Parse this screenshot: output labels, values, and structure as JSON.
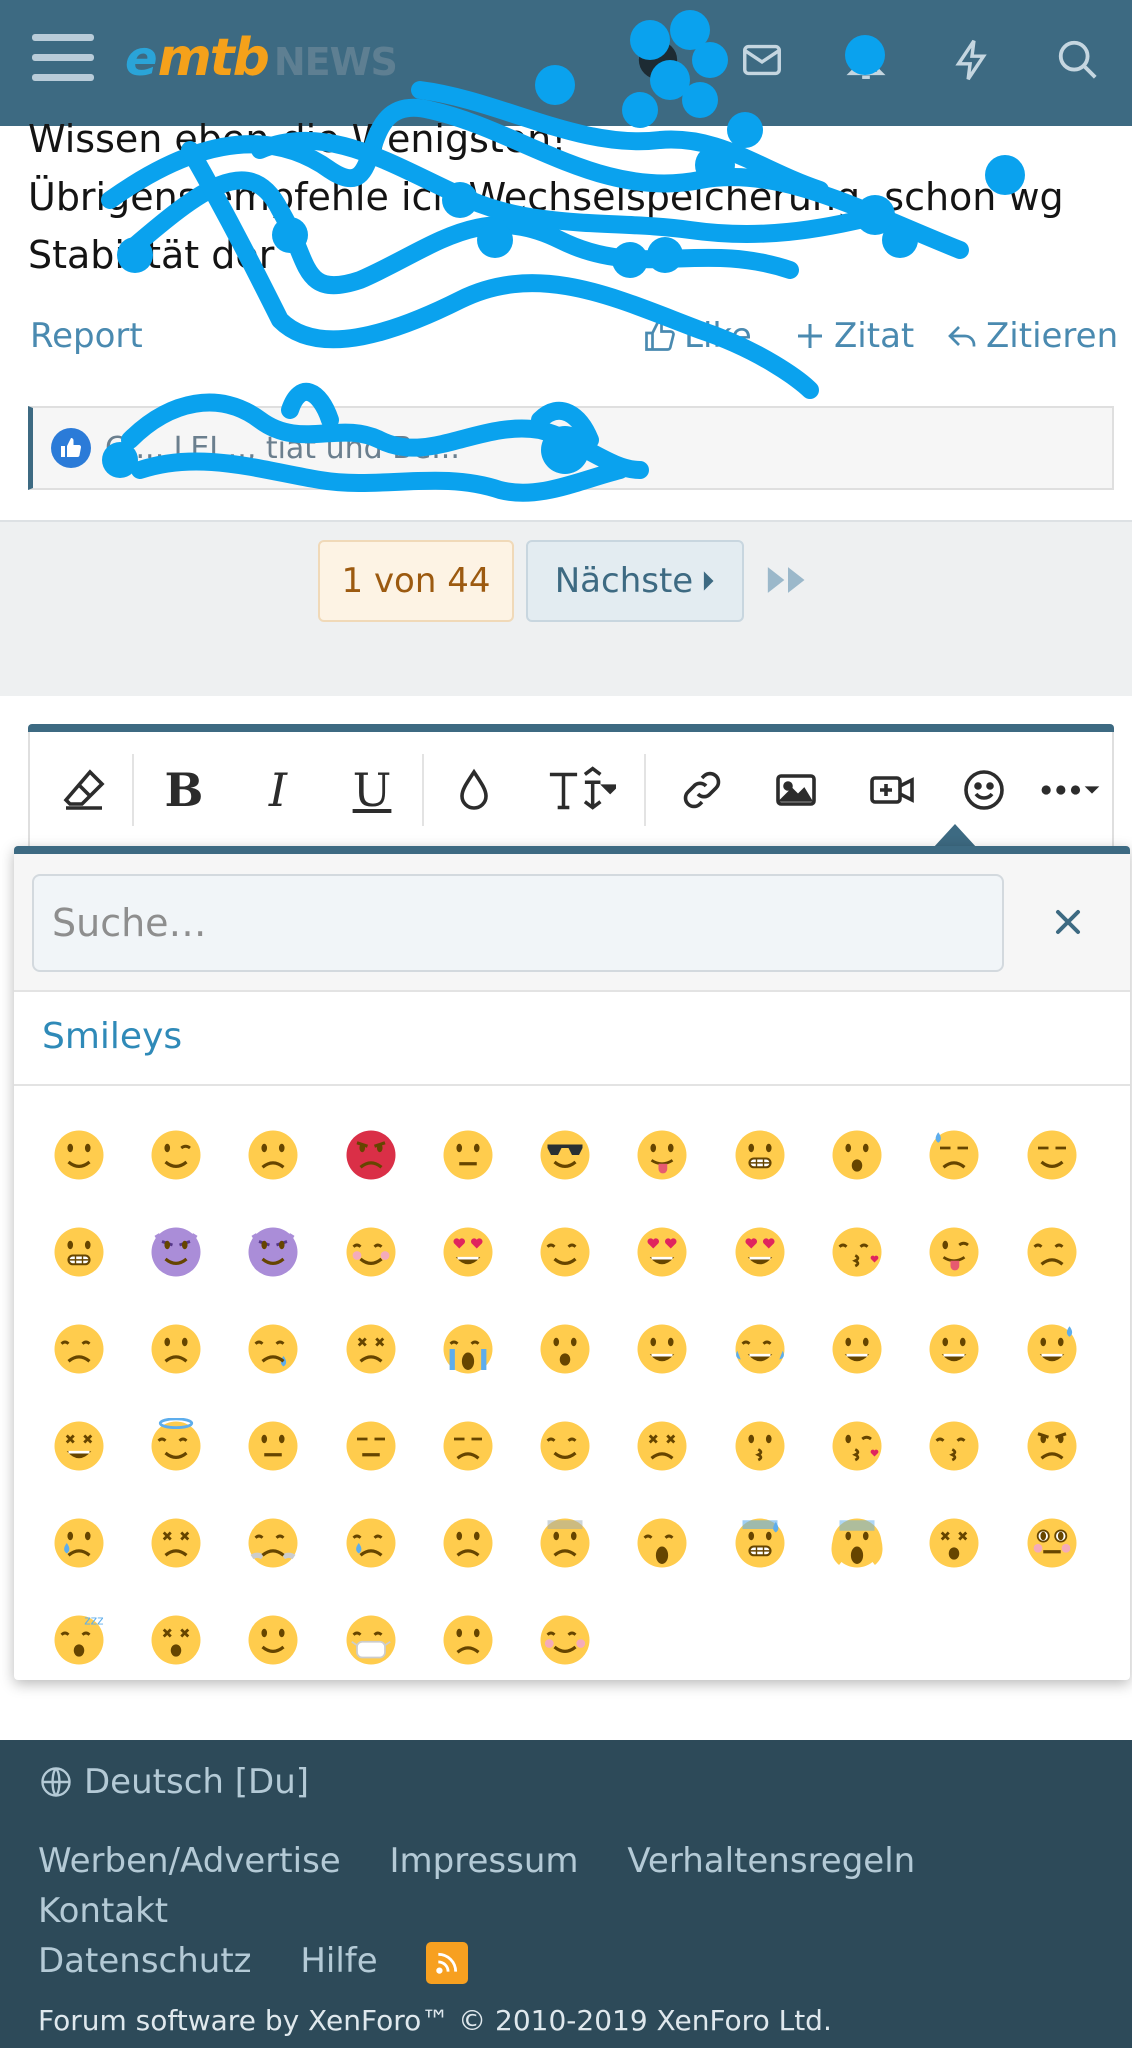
{
  "header": {
    "logo": {
      "e": "e",
      "mtb": "mtb",
      "news": "NEWS"
    },
    "icons": [
      "menu-icon",
      "avatar",
      "inbox-icon",
      "bell-icon",
      "bolt-icon",
      "search-icon"
    ]
  },
  "post": {
    "line1": "Wissen eben die Wenigsten!",
    "line2": "Übrigens empfehle ich Wechselspeicherung, schon wg",
    "line3": "Stabilität der",
    "report": "Report",
    "like": "Like",
    "quote_plus": "Zitat",
    "quote": "Zitieren",
    "reactions_text": "C..., LEI..., tiat und Be..."
  },
  "pagination": {
    "current": "1 von 44",
    "next": "Nächste"
  },
  "editor": {
    "tools": [
      "eraser-icon",
      "bold",
      "italic",
      "underline",
      "color-icon",
      "text-size-icon",
      "link-icon",
      "image-icon",
      "video-icon",
      "smiley-icon",
      "more-icon"
    ],
    "bold_label": "B",
    "italic_label": "I",
    "underline_label": "U"
  },
  "emoji_popup": {
    "search_placeholder": "Suche…",
    "category": "Smileys",
    "count": 61
  },
  "footer": {
    "language": "Deutsch [Du]",
    "links": [
      "Werben/Advertise",
      "Impressum",
      "Verhaltensregeln",
      "Kontakt",
      "Datenschutz",
      "Hilfe"
    ],
    "copyright": "Forum software by XenForo™ © 2010-2019 XenForo Ltd."
  },
  "colors": {
    "header": "#3d6a82",
    "footer": "#2d4a59",
    "link": "#4a8ab0",
    "scribble": "#0aa2ee"
  }
}
